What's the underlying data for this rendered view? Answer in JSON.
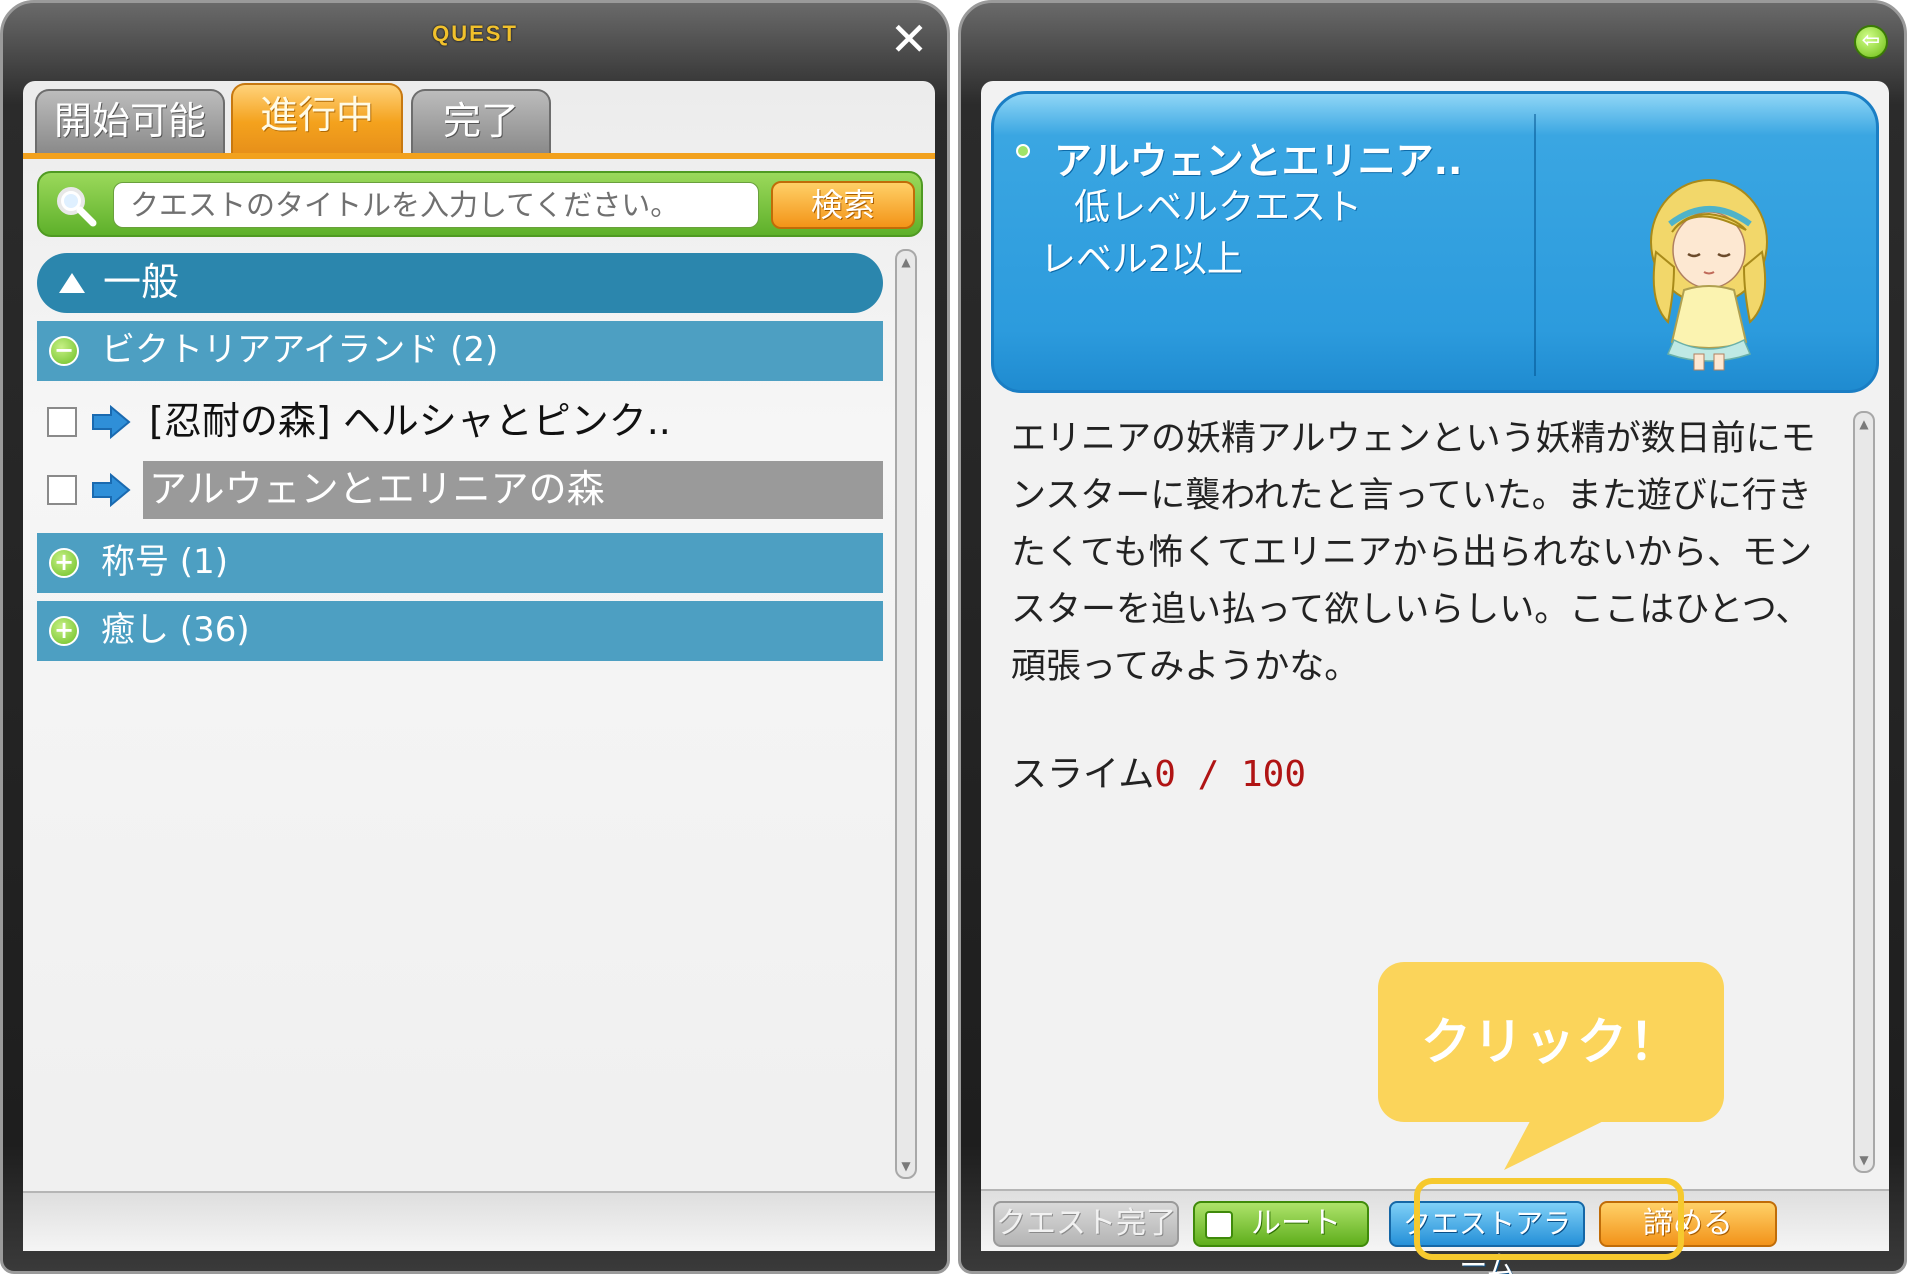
{
  "left_window": {
    "title": "QUEST",
    "tabs": [
      {
        "label": "開始可能",
        "active": false
      },
      {
        "label": "進行中",
        "active": true
      },
      {
        "label": "完了",
        "active": false
      }
    ],
    "search": {
      "placeholder": "クエストのタイトルを入力してください。",
      "button_label": "検索"
    },
    "categories": {
      "general_label": "一般",
      "groups": [
        {
          "label": "ビクトリアアイランド (2)",
          "expanded": true,
          "items": [
            {
              "label": "[忍耐の森] ヘルシャとピンク..",
              "selected": false
            },
            {
              "label": "アルウェンとエリニアの森",
              "selected": true
            }
          ]
        },
        {
          "label": "称号 (1)",
          "expanded": false
        },
        {
          "label": "癒し (36)",
          "expanded": false
        }
      ]
    }
  },
  "right_window": {
    "quest_name": "アルウェンとエリニア..",
    "quest_type": "低レベルクエスト",
    "level_req": "レベル2以上",
    "description": "エリニアの妖精アルウェンという妖精が数日前にモンスターに襲われたと言っていた。また遊びに行きたくても怖くてエリニアから出られないから、モンスターを追い払って欲しいらしい。ここはひとつ、頑張ってみようかな。",
    "progress": {
      "target": "スライム",
      "count": "0 / 100"
    },
    "buttons": {
      "complete": "クエスト完了",
      "route": "ルート",
      "alarm": "クエストアラーム",
      "give_up": "諦める"
    }
  },
  "annotation": {
    "callout_text": "クリック！",
    "highlight_color": "#f6c92e",
    "callout_color": "#fbd45a"
  },
  "colors": {
    "tab_active": "#f4a21d",
    "category_general": "#2b86ad",
    "category_bar": "#4d9fc2",
    "header_blue": "#2c9bdd",
    "progress_red": "#b01414"
  }
}
